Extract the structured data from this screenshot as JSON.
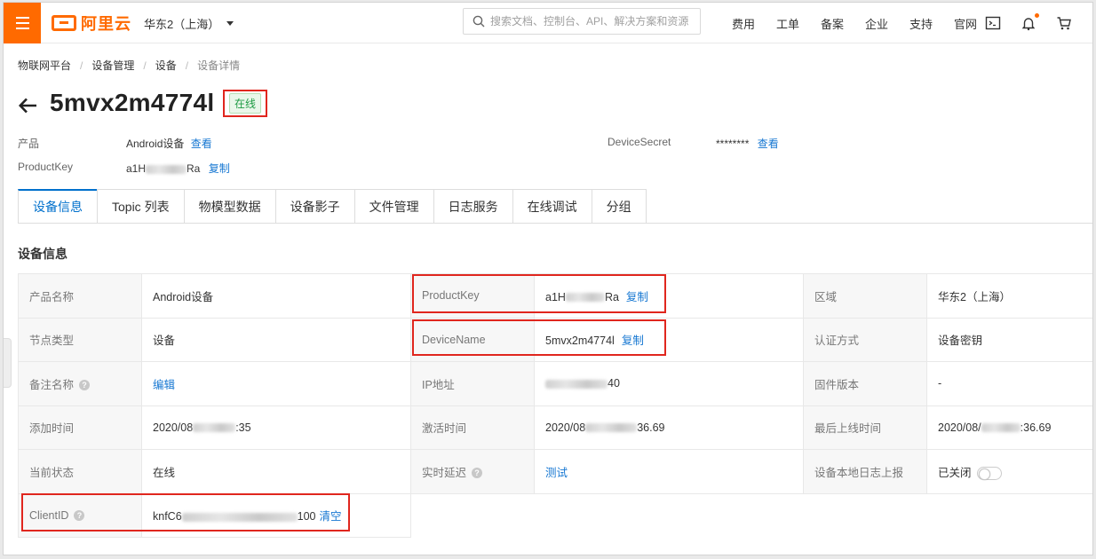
{
  "topbar": {
    "logo_text": "阿里云",
    "region": "华东2（上海）",
    "search_placeholder": "搜索文档、控制台、API、解决方案和资源",
    "links": [
      "费用",
      "工单",
      "备案",
      "企业",
      "支持",
      "官网"
    ],
    "accent_color": "#ff6a00"
  },
  "breadcrumb": [
    "物联网平台",
    "设备管理",
    "设备",
    "设备详情"
  ],
  "device": {
    "name": "5mvx2m4774l",
    "status": "在线"
  },
  "meta": {
    "product_label": "产品",
    "product_value": "Android设备",
    "product_link": "查看",
    "productkey_label": "ProductKey",
    "productkey_prefix": "a1H",
    "productkey_suffix": "Ra",
    "copy": "复制",
    "secret_label": "DeviceSecret",
    "secret_value": "********",
    "secret_link": "查看"
  },
  "tabs": [
    "设备信息",
    "Topic 列表",
    "物模型数据",
    "设备影子",
    "文件管理",
    "日志服务",
    "在线调试",
    "分组"
  ],
  "section_title": "设备信息",
  "info": {
    "r1": {
      "k1": "产品名称",
      "v1": "Android设备",
      "k2": "ProductKey",
      "v2_prefix": "a1H",
      "v2_suffix": "Ra",
      "v2_link": "复制",
      "k3": "区域",
      "v3": "华东2（上海）"
    },
    "r2": {
      "k1": "节点类型",
      "v1": "设备",
      "k2": "DeviceName",
      "v2": "5mvx2m4774l",
      "v2_link": "复制",
      "k3": "认证方式",
      "v3": "设备密钥"
    },
    "r3": {
      "k1": "备注名称",
      "v1": "编辑",
      "k2": "IP地址",
      "v2_suffix": "40",
      "k3": "固件版本",
      "v3": "-"
    },
    "r4": {
      "k1": "添加时间",
      "v1_prefix": "2020/08",
      "v1_suffix": ":35",
      "k2": "激活时间",
      "v2_prefix": "2020/08",
      "v2_suffix": "36.69",
      "k3": "最后上线时间",
      "v3_prefix": "2020/08/",
      "v3_suffix": ":36.69"
    },
    "r5": {
      "k1": "当前状态",
      "v1": "在线",
      "k2": "实时延迟",
      "v2": "测试",
      "k3": "设备本地日志上报",
      "v3": "已关闭"
    },
    "r6": {
      "k1": "ClientID",
      "v1_prefix": "knfC6",
      "v1_suffix": "100",
      "v1_link": "清空"
    }
  }
}
